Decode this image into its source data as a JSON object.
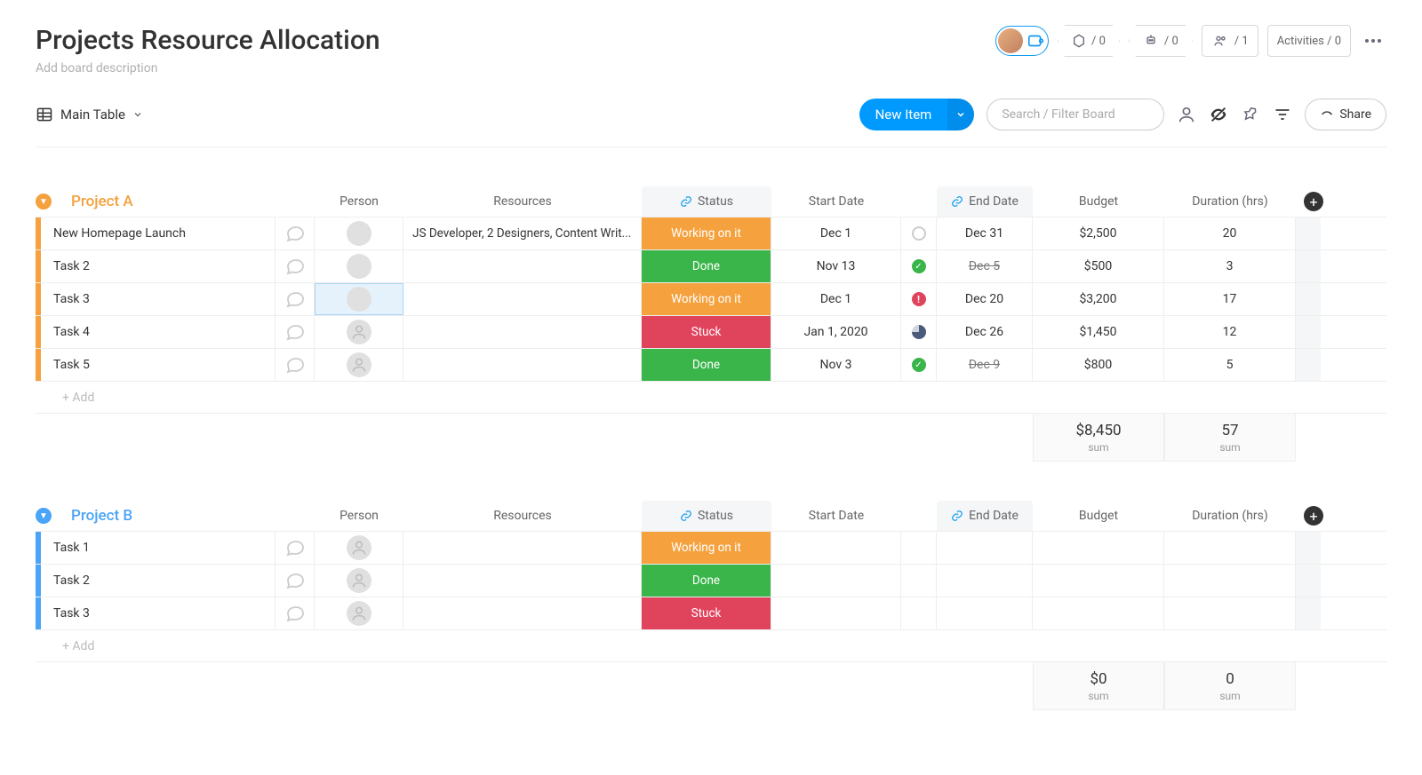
{
  "header": {
    "title": "Projects Resource Allocation",
    "description_placeholder": "Add board description",
    "badges": {
      "integrations": "/ 0",
      "automations": "/ 0",
      "members": "/ 1",
      "activities": "Activities / 0"
    }
  },
  "toolbar": {
    "view_label": "Main Table",
    "new_item_label": "New Item",
    "search_placeholder": "Search / Filter Board",
    "share_label": "Share"
  },
  "columns": {
    "person": "Person",
    "resources": "Resources",
    "status": "Status",
    "start": "Start Date",
    "end": "End Date",
    "budget": "Budget",
    "duration": "Duration (hrs)"
  },
  "groups": [
    {
      "name": "Project A",
      "color": "orange",
      "rows": [
        {
          "name": "New Homepage Launch",
          "person": "img1",
          "resources": "JS Developer, 2 Designers, Content Writ...",
          "status": "Working on it",
          "status_class": "st-working",
          "start": "Dec 1",
          "end_icon": "empty",
          "end": "Dec 31",
          "end_strike": false,
          "budget": "$2,500",
          "duration": "20"
        },
        {
          "name": "Task 2",
          "person": "img2",
          "resources": "",
          "status": "Done",
          "status_class": "st-done",
          "start": "Nov 13",
          "end_icon": "done",
          "end": "Dec 5",
          "end_strike": true,
          "budget": "$500",
          "duration": "3"
        },
        {
          "name": "Task 3",
          "person": "img3",
          "person_selected": true,
          "resources": "",
          "status": "Working on it",
          "status_class": "st-working",
          "start": "Dec 1",
          "end_icon": "warn",
          "end": "Dec 20",
          "end_strike": false,
          "budget": "$3,200",
          "duration": "17"
        },
        {
          "name": "Task 4",
          "person": "",
          "resources": "",
          "status": "Stuck",
          "status_class": "st-stuck",
          "start": "Jan 1, 2020",
          "end_icon": "prog",
          "end": "Dec 26",
          "end_strike": false,
          "budget": "$1,450",
          "duration": "12"
        },
        {
          "name": "Task 5",
          "person": "",
          "resources": "",
          "status": "Done",
          "status_class": "st-done",
          "start": "Nov 3",
          "end_icon": "done",
          "end": "Dec 9",
          "end_strike": true,
          "budget": "$800",
          "duration": "5"
        }
      ],
      "add_label": "+ Add",
      "sum": {
        "budget": "$8,450",
        "duration": "57",
        "label": "sum"
      }
    },
    {
      "name": "Project B",
      "color": "blue",
      "rows": [
        {
          "name": "Task 1",
          "person": "",
          "resources": "",
          "status": "Working on it",
          "status_class": "st-working",
          "start": "",
          "end_icon": "",
          "end": "",
          "end_strike": false,
          "budget": "",
          "duration": ""
        },
        {
          "name": "Task 2",
          "person": "",
          "resources": "",
          "status": "Done",
          "status_class": "st-done",
          "start": "",
          "end_icon": "",
          "end": "",
          "end_strike": false,
          "budget": "",
          "duration": ""
        },
        {
          "name": "Task 3",
          "person": "",
          "resources": "",
          "status": "Stuck",
          "status_class": "st-stuck",
          "start": "",
          "end_icon": "",
          "end": "",
          "end_strike": false,
          "budget": "",
          "duration": ""
        }
      ],
      "add_label": "+ Add",
      "sum": {
        "budget": "$0",
        "duration": "0",
        "label": "sum"
      }
    }
  ]
}
